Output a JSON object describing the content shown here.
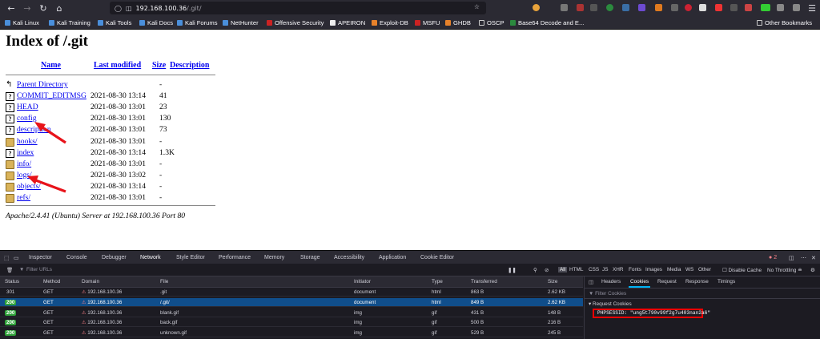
{
  "browser": {
    "url_host": "192.168.100.36",
    "url_path": "/.git/",
    "bookmarks": [
      "Kali Linux",
      "Kali Training",
      "Kali Tools",
      "Kali Docs",
      "Kali Forums",
      "NetHunter",
      "Offensive Security",
      "APEIRON",
      "Exploit-DB",
      "MSFU",
      "GHDB",
      "OSCP",
      "Base64 Decode and E...",
      "Other Bookmarks"
    ]
  },
  "page": {
    "title": "Index of /.git",
    "headers": {
      "name": "Name",
      "modified": "Last modified",
      "size": "Size",
      "description": "Description"
    },
    "rows": [
      {
        "name": "Parent Directory",
        "date": "",
        "size": "-",
        "icon": "back-icon"
      },
      {
        "name": "COMMIT_EDITMSG",
        "date": "2021-08-30 13:14",
        "size": "41",
        "icon": "file-icon"
      },
      {
        "name": "HEAD",
        "date": "2021-08-30 13:01",
        "size": "23",
        "icon": "file-icon"
      },
      {
        "name": "config",
        "date": "2021-08-30 13:01",
        "size": "130",
        "icon": "file-icon"
      },
      {
        "name": "description",
        "date": "2021-08-30 13:01",
        "size": "73",
        "icon": "file-icon"
      },
      {
        "name": "hooks/",
        "date": "2021-08-30 13:01",
        "size": "-",
        "icon": "folder-icon"
      },
      {
        "name": "index",
        "date": "2021-08-30 13:14",
        "size": "1.3K",
        "icon": "file-icon"
      },
      {
        "name": "info/",
        "date": "2021-08-30 13:01",
        "size": "-",
        "icon": "folder-icon"
      },
      {
        "name": "logs/",
        "date": "2021-08-30 13:02",
        "size": "-",
        "icon": "folder-icon"
      },
      {
        "name": "objects/",
        "date": "2021-08-30 13:14",
        "size": "-",
        "icon": "folder-icon"
      },
      {
        "name": "refs/",
        "date": "2021-08-30 13:01",
        "size": "-",
        "icon": "folder-icon"
      }
    ],
    "address": "Apache/2.4.41 (Ubuntu) Server at 192.168.100.36 Port 80"
  },
  "devtools": {
    "tabs": [
      "Inspector",
      "Console",
      "Debugger",
      "Network",
      "Style Editor",
      "Performance",
      "Memory",
      "Storage",
      "Accessibility",
      "Application",
      "Cookie Editor"
    ],
    "selected_tab": "Network",
    "error_count": "2",
    "filter_placeholder": "Filter URLs",
    "types": [
      "All",
      "HTML",
      "CSS",
      "JS",
      "XHR",
      "Fonts",
      "Images",
      "Media",
      "WS",
      "Other"
    ],
    "disable_cache": "Disable Cache",
    "throttling": "No Throttling ≘",
    "columns": [
      "Status",
      "Method",
      "Domain",
      "File",
      "Initiator",
      "Type",
      "Transferred",
      "Size"
    ],
    "requests": [
      {
        "status": "301",
        "method": "GET",
        "domain": "192.168.100.36",
        "file": ".git",
        "initiator": "document",
        "type": "html",
        "transferred": "863 B",
        "size": "2.62 KB"
      },
      {
        "status": "200",
        "method": "GET",
        "domain": "192.168.100.36",
        "file": "/.git/",
        "initiator": "document",
        "type": "html",
        "transferred": "849 B",
        "size": "2.62 KB"
      },
      {
        "status": "200",
        "method": "GET",
        "domain": "192.168.100.36",
        "file": "blank.gif",
        "initiator": "img",
        "type": "gif",
        "transferred": "431 B",
        "size": "148 B"
      },
      {
        "status": "200",
        "method": "GET",
        "domain": "192.168.100.36",
        "file": "back.gif",
        "initiator": "img",
        "type": "gif",
        "transferred": "500 B",
        "size": "216 B"
      },
      {
        "status": "200",
        "method": "GET",
        "domain": "192.168.100.36",
        "file": "unknown.gif",
        "initiator": "img",
        "type": "gif",
        "transferred": "529 B",
        "size": "245 B"
      }
    ],
    "side_tabs": [
      "Headers",
      "Cookies",
      "Request",
      "Response",
      "Timings"
    ],
    "side_selected": "Cookies",
    "filter_cookies": "Filter Cookies",
    "request_cookies": "Request Cookies",
    "cookie": "PHPSESSID: \"ung5t790v99f2g7u403nan2a6\""
  }
}
